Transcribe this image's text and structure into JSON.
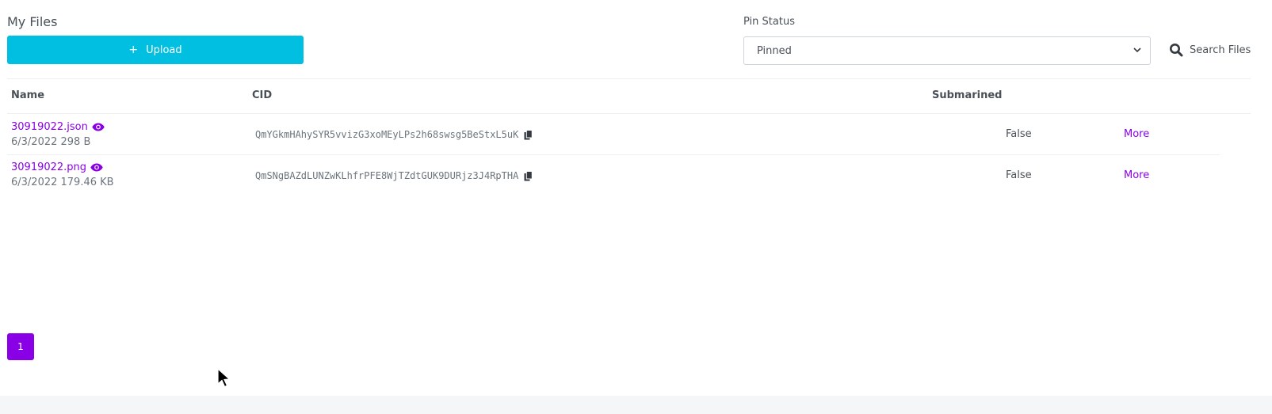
{
  "header": {
    "title": "My Files",
    "upload_plus": "+",
    "upload_label": "Upload"
  },
  "filter": {
    "label": "Pin Status",
    "selected": "Pinned",
    "search_label": "Search Files"
  },
  "table": {
    "columns": {
      "name": "Name",
      "cid": "CID",
      "submarined": "Submarined"
    },
    "rows": [
      {
        "name": "30919022.json",
        "meta": "6/3/2022 298 B",
        "cid": "QmYGkmHAhySYR5vvizG3xoMEyLPs2h68swsg5BeStxL5uK",
        "submarined": "False",
        "more": "More"
      },
      {
        "name": "30919022.png",
        "meta": "6/3/2022 179.46 KB",
        "cid": "QmSNgBAZdLUNZwKLhfrPFE8WjTZdtGUK9DURjz3J4RpTHA",
        "submarined": "False",
        "more": "More"
      }
    ]
  },
  "pagination": {
    "current_page": "1"
  },
  "colors": {
    "primary": "#00bfe0",
    "accent": "#8a00e6",
    "text": "#495057"
  }
}
